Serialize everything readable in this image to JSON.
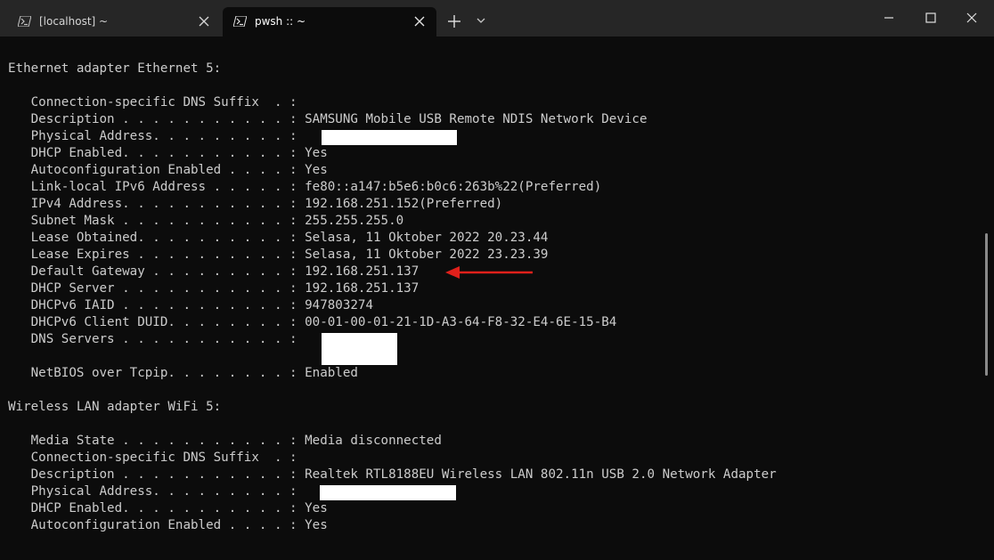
{
  "window": {
    "tabs": [
      {
        "label": "[localhost] ~",
        "icon": "powershell-icon",
        "active": false
      },
      {
        "label": "pwsh :: ~",
        "icon": "powershell-icon",
        "active": true
      }
    ]
  },
  "terminal": {
    "lines": [
      "Ethernet adapter Ethernet 5:",
      "",
      "   Connection-specific DNS Suffix  . :",
      "   Description . . . . . . . . . . . : SAMSUNG Mobile USB Remote NDIS Network Device",
      "   Physical Address. . . . . . . . . :",
      "   DHCP Enabled. . . . . . . . . . . : Yes",
      "   Autoconfiguration Enabled . . . . : Yes",
      "   Link-local IPv6 Address . . . . . : fe80::a147:b5e6:b0c6:263b%22(Preferred)",
      "   IPv4 Address. . . . . . . . . . . : 192.168.251.152(Preferred)",
      "   Subnet Mask . . . . . . . . . . . : 255.255.255.0",
      "   Lease Obtained. . . . . . . . . . : Selasa, 11 Oktober 2022 20.23.44",
      "   Lease Expires . . . . . . . . . . : Selasa, 11 Oktober 2022 23.23.39",
      "   Default Gateway . . . . . . . . . : 192.168.251.137",
      "   DHCP Server . . . . . . . . . . . : 192.168.251.137",
      "   DHCPv6 IAID . . . . . . . . . . . : 947803274",
      "   DHCPv6 Client DUID. . . . . . . . : 00-01-00-01-21-1D-A3-64-F8-32-E4-6E-15-B4",
      "   DNS Servers . . . . . . . . . . . :",
      "",
      "   NetBIOS over Tcpip. . . . . . . . : Enabled",
      "",
      "Wireless LAN adapter WiFi 5:",
      "",
      "   Media State . . . . . . . . . . . : Media disconnected",
      "   Connection-specific DNS Suffix  . :",
      "   Description . . . . . . . . . . . : Realtek RTL8188EU Wireless LAN 802.11n USB 2.0 Network Adapter",
      "   Physical Address. . . . . . . . . :",
      "   DHCP Enabled. . . . . . . . . . . : Yes",
      "   Autoconfiguration Enabled . . . . : Yes"
    ]
  },
  "colors": {
    "background": "#0c0c0c",
    "text": "#cccccc",
    "annotation_arrow": "#e0201b",
    "redaction": "#ffffff"
  }
}
